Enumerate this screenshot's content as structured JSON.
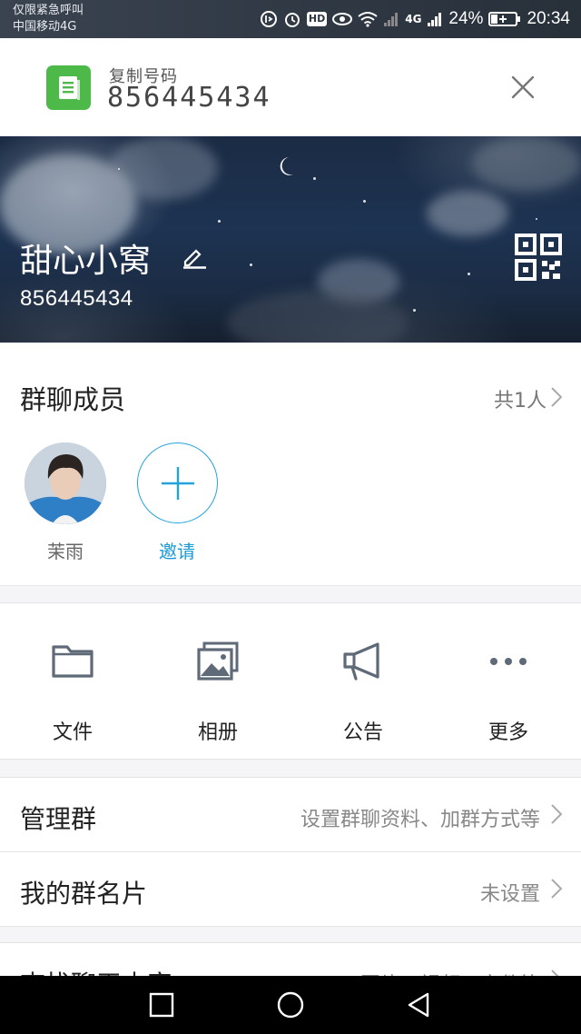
{
  "status_bar": {
    "carrier_line1": "仅限紧急呼叫",
    "carrier_line2": "中国移动4G",
    "hd_label": "HD",
    "network_label": "4G",
    "battery": "24%",
    "time": "20:34"
  },
  "copy_banner": {
    "label": "复制号码",
    "number": "856445434",
    "icon": "document-icon",
    "close_icon": "close-icon"
  },
  "group": {
    "name": "甜心小窝",
    "id": "856445434",
    "edit_icon": "pencil-icon",
    "qr_icon": "qr-code-icon"
  },
  "members": {
    "title": "群聊成员",
    "count": "共1人",
    "list": [
      {
        "name": "茉雨"
      }
    ],
    "invite_label": "邀请"
  },
  "features": [
    {
      "label": "文件",
      "icon": "folder-icon"
    },
    {
      "label": "相册",
      "icon": "album-icon"
    },
    {
      "label": "公告",
      "icon": "megaphone-icon"
    },
    {
      "label": "更多",
      "icon": "more-icon"
    }
  ],
  "rows": {
    "manage": {
      "title": "管理群",
      "value": "设置群聊资料、加群方式等"
    },
    "card": {
      "title": "我的群名片",
      "value": "未设置"
    },
    "search": {
      "title": "查找聊天内容",
      "value": "图片、视频、文件等"
    }
  },
  "colors": {
    "accent": "#1a9ad6",
    "copy_icon_bg": "#4cb948",
    "icon_gray": "#5f6a78"
  }
}
